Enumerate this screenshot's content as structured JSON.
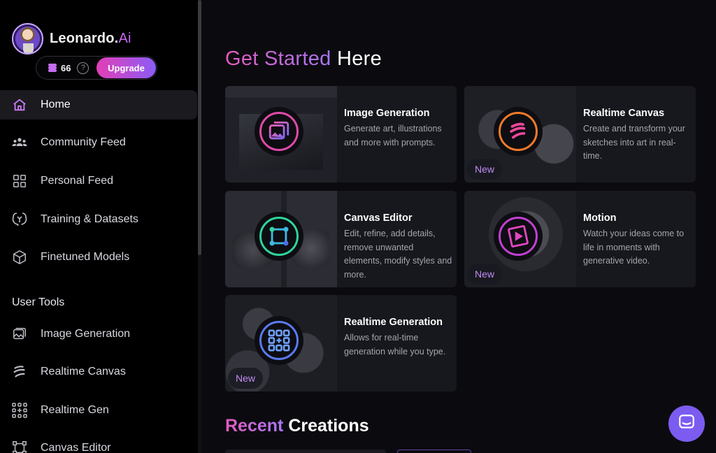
{
  "brand": {
    "name": "Leonardo.",
    "suffix": "Ai"
  },
  "account": {
    "tokens": "66",
    "help": "?",
    "upgrade_label": "Upgrade"
  },
  "nav": {
    "home": "Home",
    "community_feed": "Community Feed",
    "personal_feed": "Personal Feed",
    "training_datasets": "Training & Datasets",
    "finetuned_models": "Finetuned Models",
    "user_tools_label": "User Tools",
    "image_generation": "Image Generation",
    "realtime_canvas": "Realtime Canvas",
    "realtime_gen": "Realtime Gen",
    "canvas_editor": "Canvas Editor"
  },
  "main": {
    "title_accent": "Get Started",
    "title_rest": " Here",
    "recent_accent": "Recent",
    "recent_rest": " Creations"
  },
  "cards": [
    {
      "title": "Image Generation",
      "desc": "Generate art, illustrations and more with prompts.",
      "badge": ""
    },
    {
      "title": "Realtime Canvas",
      "desc": "Create and transform your sketches into art in real-time.",
      "badge": "New"
    },
    {
      "title": "Canvas Editor",
      "desc": "Edit, refine, add details, remove unwanted elements, modify styles and more.",
      "badge": ""
    },
    {
      "title": "Motion",
      "desc": "Watch your ideas come to life in moments with generative video.",
      "badge": "New"
    },
    {
      "title": "Realtime Generation",
      "desc": "Allows for real-time generation while you type.",
      "badge": "New"
    }
  ],
  "colors": {
    "accent_pink": "#e23fb6",
    "accent_purple": "#8b5cf6",
    "sidebar_active": "#1a1a1f",
    "chat": "#7c5cf0"
  }
}
